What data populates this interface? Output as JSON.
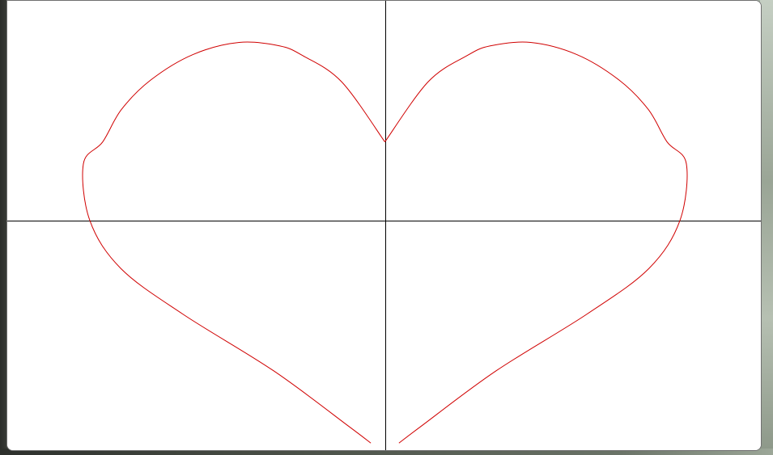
{
  "colors": {
    "canvas_background": "#ffffff",
    "axis": "#000000",
    "curve": "#d00000",
    "window_border": "#6f6f6f"
  },
  "chart_data": {
    "type": "line",
    "curve": "heart",
    "x_range": [
      -12.9,
      12.9
    ],
    "y_range": [
      -8,
      7.6
    ],
    "axes_visible": true,
    "grid": false,
    "series": [
      {
        "x": [
          0,
          1.48,
          2.8,
          3.6,
          4.98,
          6.56,
          8.0,
          9.0,
          9.64,
          10.3,
          10.08,
          9.02,
          6.9,
          3.8,
          1.26,
          0.48
        ],
        "y": [
          2.72,
          4.8,
          5.7,
          6.04,
          6.16,
          5.74,
          4.86,
          3.84,
          2.72,
          1.96,
          0.0,
          -1.66,
          -3.24,
          -5.2,
          -7.1,
          -7.7
        ]
      }
    ]
  }
}
